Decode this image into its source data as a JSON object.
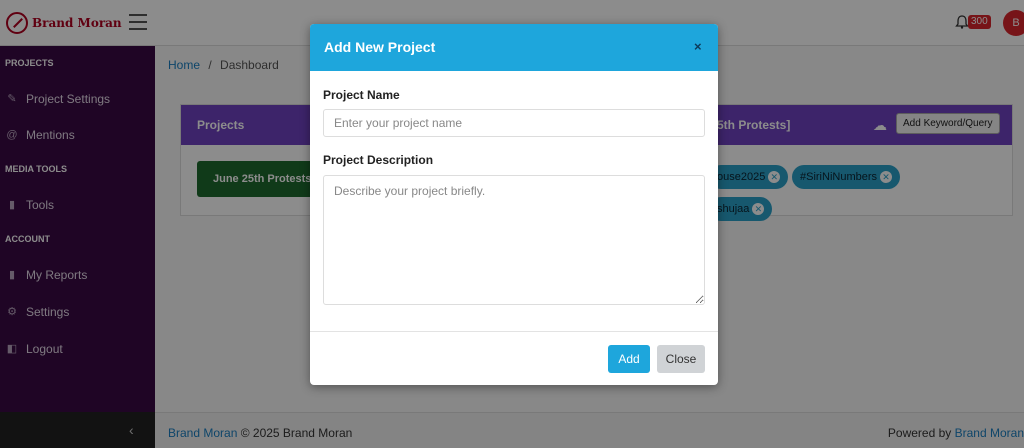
{
  "brand": {
    "name": "Brand Moran"
  },
  "header": {
    "notification_count": "300",
    "avatar_initial": "B"
  },
  "sidebar": {
    "sections": [
      {
        "label": "PROJECTS"
      },
      {
        "label": "MEDIA TOOLS"
      },
      {
        "label": "ACCOUNT"
      }
    ],
    "items": [
      {
        "label": "Project Settings",
        "icon": "pencil-icon"
      },
      {
        "label": "Mentions",
        "icon": "at-icon"
      },
      {
        "label": "Tools",
        "icon": "bar-chart-icon"
      },
      {
        "label": "My Reports",
        "icon": "bar-chart-icon"
      },
      {
        "label": "Settings",
        "icon": "gear-icon"
      },
      {
        "label": "Logout",
        "icon": "lock-icon"
      }
    ]
  },
  "breadcrumb": {
    "home": "Home",
    "separator": "/",
    "current": "Dashboard"
  },
  "projects_card": {
    "title": "Projects",
    "project_button": "June 25th Protests",
    "selected_label": "5th Protests]",
    "add_keyword_button": "Add Keyword/Query",
    "tags": [
      {
        "label": "ouse2025"
      },
      {
        "label": "#SiriNiNumbers"
      },
      {
        "label": "shujaa"
      }
    ]
  },
  "modal": {
    "title": "Add New Project",
    "close_symbol": "×",
    "name_label": "Project Name",
    "name_placeholder": "Enter your project name",
    "name_value": "",
    "description_label": "Project Description",
    "description_placeholder": "Describe your project briefly.",
    "description_value": "",
    "add_button": "Add",
    "close_button": "Close"
  },
  "footer": {
    "brand_link": "Brand Moran",
    "copyright": "© 2025 Brand Moran",
    "powered_by": "Powered by",
    "powered_link": "Brand Moran"
  },
  "colors": {
    "sidebar_bg": "#3a0a44",
    "card_header": "#6f42c1",
    "modal_header": "#1ea6dc",
    "tag_bg": "#2aa0c8",
    "project_button": "#1e6b2f",
    "brand": "#b00020"
  }
}
